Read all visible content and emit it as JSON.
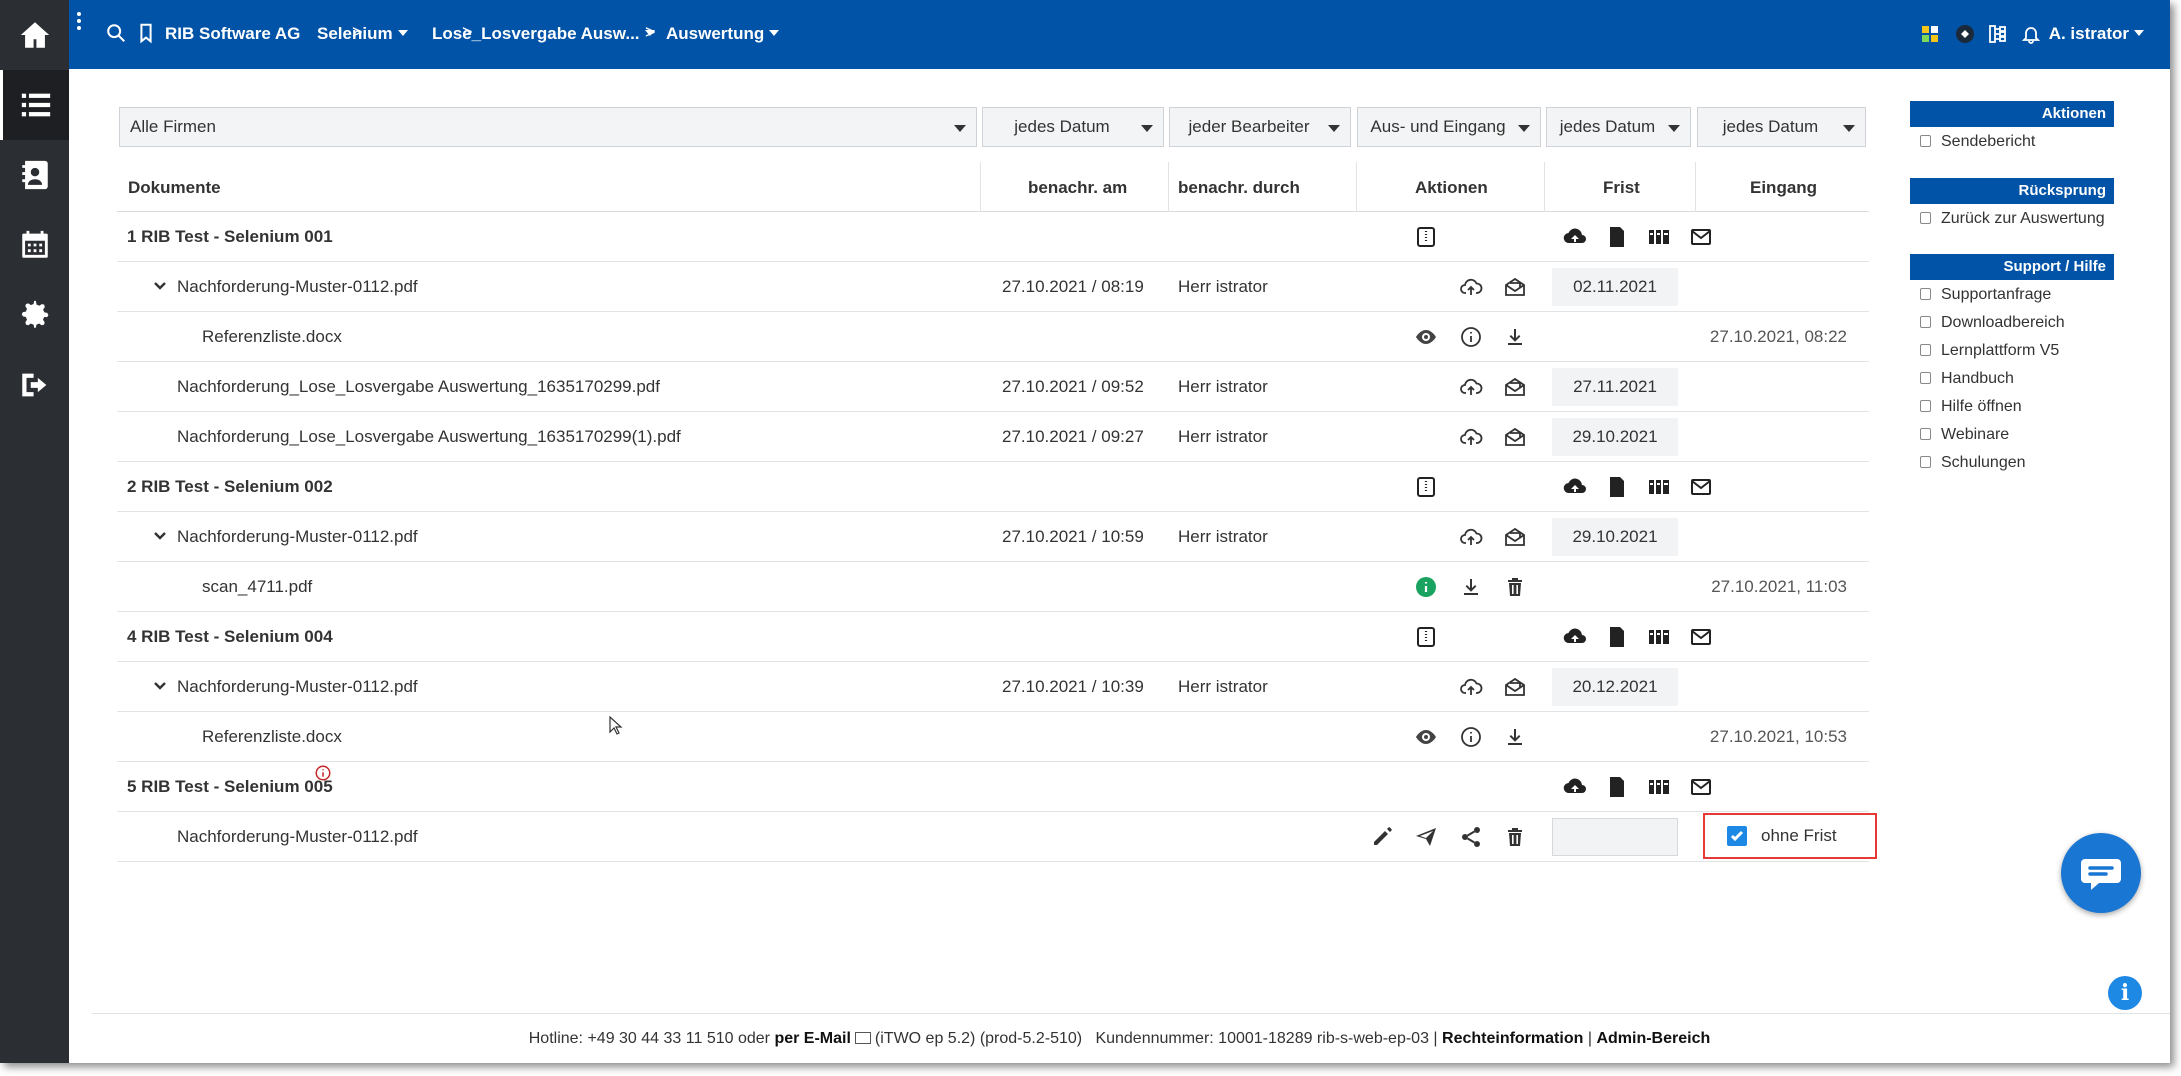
{
  "topbar": {
    "breadcrumbs": [
      {
        "label": "RIB Software AG"
      },
      {
        "label": "Selenium"
      },
      {
        "label": "Lose_Losvergabe Ausw..."
      },
      {
        "label": "Auswertung"
      }
    ],
    "user": "A. istrator"
  },
  "rail": {
    "items": [
      "home-icon",
      "list-icon",
      "contacts-icon",
      "calendar-icon",
      "settings-icon",
      "logout-icon"
    ],
    "active": "list-icon"
  },
  "filters": {
    "company": "Alle Firmen",
    "date1": "jedes Datum",
    "editor": "jeder Bearbeiter",
    "direction": "Aus- und Eingang",
    "date2": "jedes Datum",
    "date3": "jedes Datum"
  },
  "table": {
    "headers": {
      "documents": "Dokumente",
      "notified_on": "benachr. am",
      "notified_by": "benachr. durch",
      "actions": "Aktionen",
      "deadline": "Frist",
      "received": "Eingang"
    },
    "rows": [
      {
        "kind": "group",
        "name": "1 RIB Test - Selenium 001"
      },
      {
        "kind": "doc",
        "name": "Nachforderung-Muster-0112.pdf",
        "date": "27.10.2021 / 08:19",
        "by": "Herr istrator",
        "frist": "02.11.2021"
      },
      {
        "kind": "sub",
        "name": "Referenzliste.docx",
        "eingang": "27.10.2021, 08:22"
      },
      {
        "kind": "doc",
        "name": "Nachforderung_Lose_Losvergabe Auswertung_1635170299.pdf",
        "date": "27.10.2021 / 09:52",
        "by": "Herr istrator",
        "frist": "27.11.2021"
      },
      {
        "kind": "doc",
        "name": "Nachforderung_Lose_Losvergabe Auswertung_1635170299(1).pdf",
        "date": "27.10.2021 / 09:27",
        "by": "Herr istrator",
        "frist": "29.10.2021"
      },
      {
        "kind": "group",
        "name": "2 RIB Test - Selenium 002"
      },
      {
        "kind": "doc",
        "name": "Nachforderung-Muster-0112.pdf",
        "date": "27.10.2021 / 10:59",
        "by": "Herr istrator",
        "frist": "29.10.2021"
      },
      {
        "kind": "sub",
        "name": "scan_4711.pdf",
        "eingang": "27.10.2021, 11:03"
      },
      {
        "kind": "group",
        "name": "4 RIB Test - Selenium 004"
      },
      {
        "kind": "doc",
        "name": "Nachforderung-Muster-0112.pdf",
        "date": "27.10.2021 / 10:39",
        "by": "Herr istrator",
        "frist": "20.12.2021"
      },
      {
        "kind": "sub",
        "name": "Referenzliste.docx",
        "eingang": "27.10.2021, 10:53"
      },
      {
        "kind": "group",
        "name": "5 RIB Test - Selenium 005"
      },
      {
        "kind": "draft",
        "name": "Nachforderung-Muster-0112.pdf",
        "frist": "",
        "ohne_frist": "ohne Frist"
      }
    ]
  },
  "panel": {
    "aktionen": {
      "title": "Aktionen",
      "items": [
        "Sendebericht"
      ]
    },
    "ruecksprung": {
      "title": "Rücksprung",
      "items": [
        "Zurück zur Auswertung"
      ]
    },
    "support": {
      "title": "Support / Hilfe",
      "items": [
        "Supportanfrage",
        "Downloadbereich",
        "Lernplattform V5",
        "Handbuch",
        "Hilfe öffnen",
        "Webinare",
        "Schulungen"
      ]
    }
  },
  "footer": {
    "hotline": "Hotline: +49 30 44 33 11 510 oder",
    "email_link": "per E-Mail",
    "version": "(iTWO ep 5.2) (prod-5.2-510)",
    "customer": "Kundennummer: 10001-18289 rib-s-web-ep-03 |",
    "legal": "Rechteinformation",
    "sep": "|",
    "admin": "Admin-Bereich"
  },
  "colors": {
    "brand": "#0053a6",
    "rail": "#2b2e32",
    "highlight": "#e53935",
    "checkbox": "#1e88e5",
    "info_green": "#1aa260"
  }
}
